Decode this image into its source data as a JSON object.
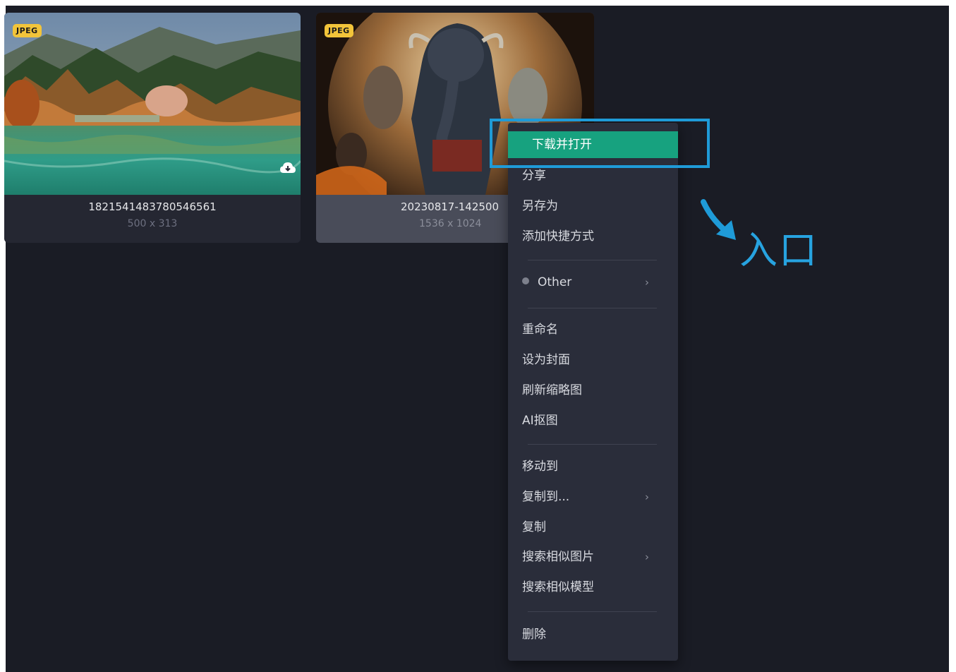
{
  "cards": [
    {
      "badge": "JPEG",
      "name": "1821541483780546561",
      "dims": "500 x 313",
      "cloud_icon": "cloud-download-icon"
    },
    {
      "badge": "JPEG",
      "name": "20230817-142500",
      "dims": "1536 x 1024"
    }
  ],
  "context_menu": {
    "download_open": "下载并打开",
    "share": "分享",
    "save_as": "另存为",
    "add_shortcut": "添加快捷方式",
    "other": "Other",
    "rename": "重命名",
    "set_cover": "设为封面",
    "refresh_thumbnail": "刷新缩略图",
    "ai_cutout": "AI抠图",
    "move_to": "移动到",
    "copy_to": "复制到...",
    "copy": "复制",
    "search_similar_images": "搜索相似图片",
    "search_similar_models": "搜索相似模型",
    "delete": "删除"
  },
  "annotation": {
    "label": "入口",
    "color": "#1f9bd8",
    "icon": "arrow-down-right-icon"
  },
  "colors": {
    "highlight": "#17a27f",
    "background": "#1a1c25",
    "badge": "#f2c43a"
  }
}
